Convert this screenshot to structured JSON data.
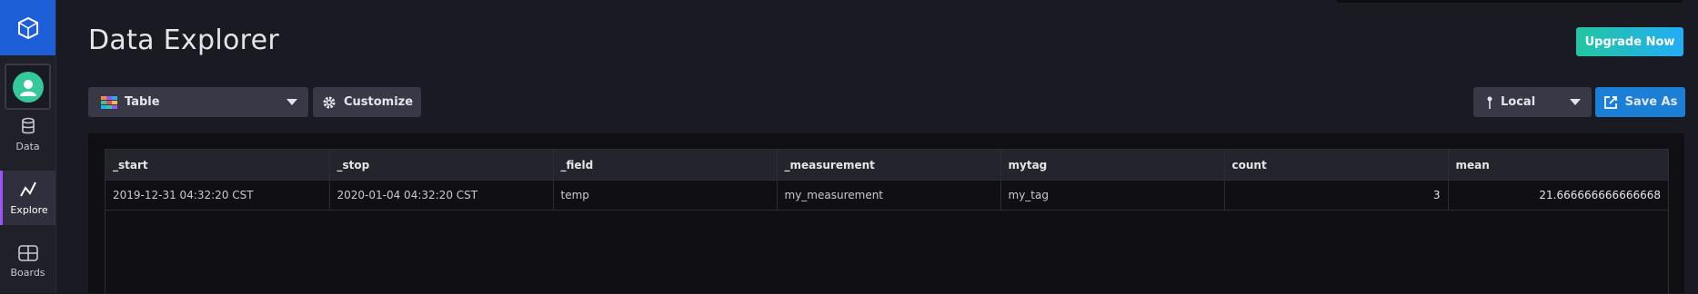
{
  "app": {
    "page_title": "Data Explorer"
  },
  "sidebar": {
    "items": [
      {
        "label": "Data",
        "icon": "database-icon"
      },
      {
        "label": "Explore",
        "icon": "graph-icon"
      },
      {
        "label": "Boards",
        "icon": "dashboard-icon"
      }
    ]
  },
  "header": {
    "upgrade_label": "Upgrade Now"
  },
  "toolbar": {
    "vis_type": "Table",
    "customize_label": "Customize",
    "timezone": "Local",
    "save_as_label": "Save As"
  },
  "table": {
    "columns": [
      "_start",
      "_stop",
      "_field",
      "_measurement",
      "mytag",
      "count",
      "mean"
    ],
    "rows": [
      [
        "2019-12-31 04:32:20 CST",
        "2020-01-04 04:32:20 CST",
        "temp",
        "my_measurement",
        "my_tag",
        "3",
        "21.666666666666668"
      ]
    ]
  },
  "colors": {
    "accent": "#9b54f5",
    "brand": "#1c5fd6",
    "save": "#1c7fd6",
    "upgrade": "#22adf6"
  }
}
